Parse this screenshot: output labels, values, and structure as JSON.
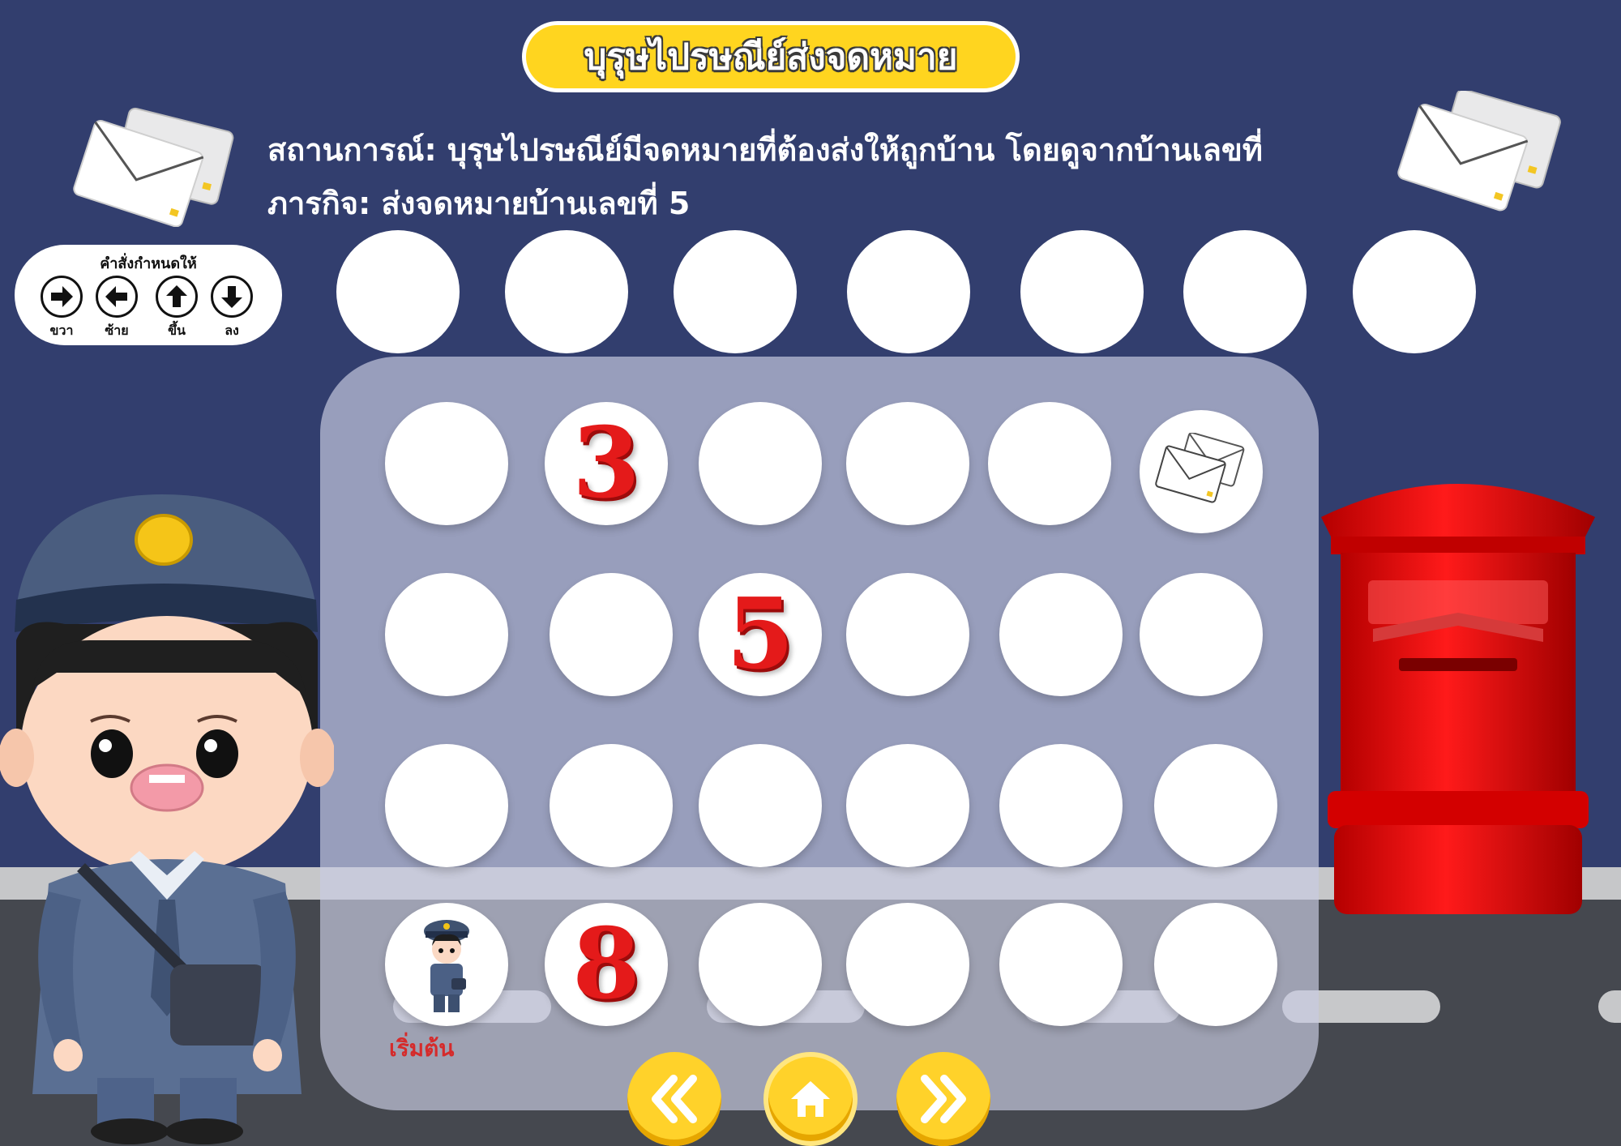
{
  "title": "บุรุษไปรษณีย์ส่งจดหมาย",
  "scenario": {
    "situation": "สถานการณ์: บุรุษไปรษณีย์มีจดหมายที่ต้องส่งให้ถูกบ้าน โดยดูจากบ้านเลขที่",
    "mission": "ภารกิจ: ส่งจดหมายบ้านเลขที่ 5"
  },
  "commands": {
    "title": "คำสั่งกำหนดให้",
    "right": "ขวา",
    "left": "ซ้าย",
    "up": "ขึ้น",
    "down": "ลง"
  },
  "answer_slots": 7,
  "board": {
    "rows": [
      [
        "",
        "3",
        "",
        "",
        "",
        "envelope"
      ],
      [
        "",
        "",
        "5",
        "",
        "",
        ""
      ],
      [
        "",
        "",
        "",
        "",
        "",
        ""
      ],
      [
        "postman",
        "8",
        "",
        "",
        "",
        ""
      ]
    ],
    "start_label": "เริ่มต้น"
  },
  "colors": {
    "background": "#323e6e",
    "title_pill": "#ffd51f",
    "number": "#e41a1a",
    "mailbox": "#e60000",
    "nav_button": "#ffd22a"
  },
  "nav": {
    "prev_icon": "double-chevron-left-icon",
    "home_icon": "home-icon",
    "next_icon": "double-chevron-right-icon"
  }
}
